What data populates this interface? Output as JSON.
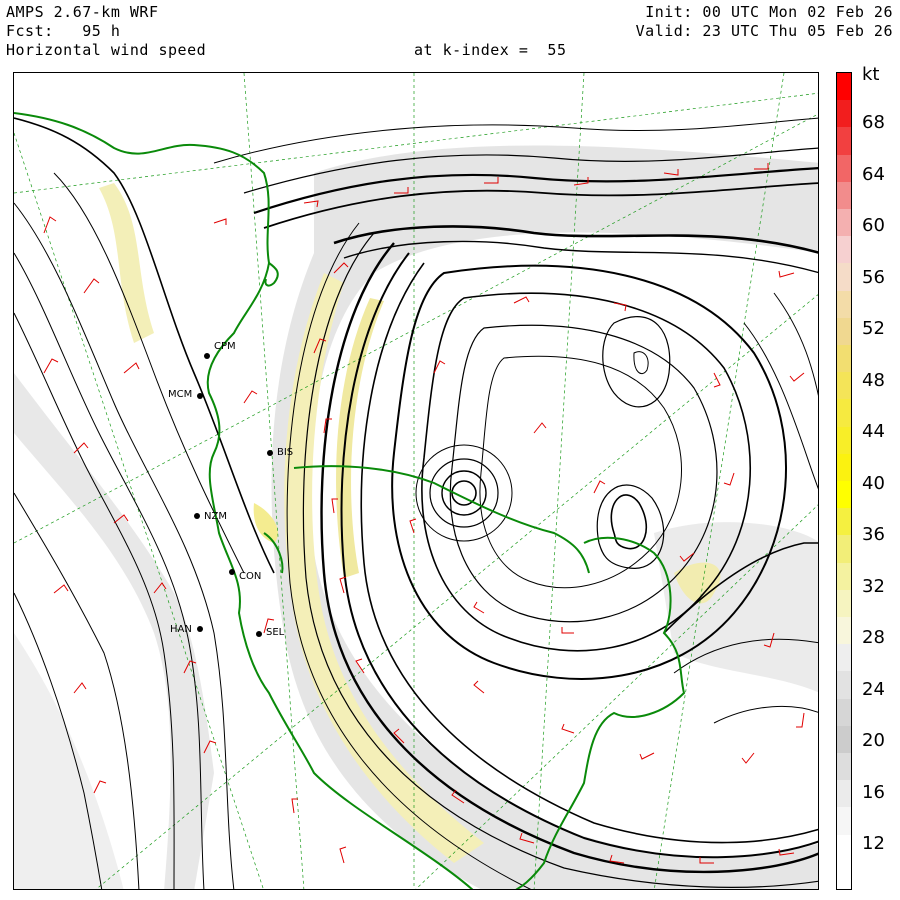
{
  "header": {
    "model": "AMPS 2.67-km WRF",
    "fcst": "Fcst:   95 h",
    "field": "Horizontal wind speed",
    "level": "at k-index =  55",
    "init": "Init: 00 UTC Mon 02 Feb 26",
    "valid": "Valid: 23 UTC Thu 05 Feb 26"
  },
  "colorbar": {
    "unit": "kt",
    "labels": [
      "68",
      "64",
      "60",
      "56",
      "52",
      "48",
      "44",
      "40",
      "36",
      "32",
      "28",
      "24",
      "20",
      "16",
      "12"
    ],
    "levels": [
      {
        "color": "#ff0000"
      },
      {
        "color": "#f21e1e"
      },
      {
        "color": "#f24040"
      },
      {
        "color": "#f26666"
      },
      {
        "color": "#f28c8c"
      },
      {
        "color": "#f4b0b0"
      },
      {
        "color": "#f6d0d0"
      },
      {
        "color": "#f5dcc8"
      },
      {
        "color": "#f3dca8"
      },
      {
        "color": "#f0d890"
      },
      {
        "color": "#f2de70"
      },
      {
        "color": "#f4e458"
      },
      {
        "color": "#f6ea40"
      },
      {
        "color": "#f8ee28"
      },
      {
        "color": "#fbf210"
      },
      {
        "color": "#ffff00"
      },
      {
        "color": "#f5f040"
      },
      {
        "color": "#f2ee78"
      },
      {
        "color": "#f4f2a0"
      },
      {
        "color": "#f6f4c0"
      },
      {
        "color": "#f8f6dc"
      },
      {
        "color": "#eeeeee"
      },
      {
        "color": "#e2e2e2"
      },
      {
        "color": "#d6d6d6"
      },
      {
        "color": "#cccccc"
      },
      {
        "color": "#dddddd"
      },
      {
        "color": "#ebebeb"
      },
      {
        "color": "#f6f6f6"
      },
      {
        "color": "#ffffff"
      },
      {
        "color": "#ffffff"
      }
    ]
  },
  "stations": [
    {
      "code": "CPM"
    },
    {
      "code": "MCM"
    },
    {
      "code": "BIS"
    },
    {
      "code": "NZM"
    },
    {
      "code": "CON"
    },
    {
      "code": "HAN"
    },
    {
      "code": "SEL"
    }
  ],
  "colors": {
    "coast": "#0a8a0a",
    "barbs": "#e00000",
    "contours": "#000000",
    "grid": "#1a9a1a"
  }
}
